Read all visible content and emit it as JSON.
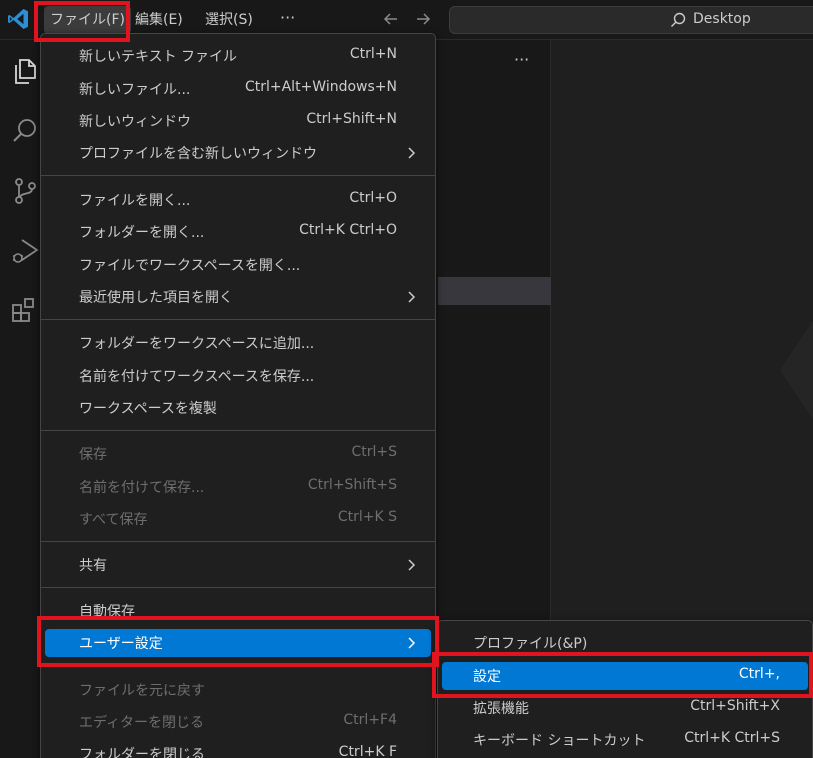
{
  "menubar": {
    "file": "ファイル(F)",
    "edit": "編集(E)",
    "selection": "選択(S)",
    "more": "···"
  },
  "search": {
    "text": "Desktop"
  },
  "sidebar": {
    "more": "···"
  },
  "file_menu": {
    "items": [
      {
        "label": "新しいテキスト ファイル",
        "shortcut": "Ctrl+N"
      },
      {
        "label": "新しいファイル...",
        "shortcut": "Ctrl+Alt+Windows+N"
      },
      {
        "label": "新しいウィンドウ",
        "shortcut": "Ctrl+Shift+N"
      },
      {
        "label": "プロファイルを含む新しいウィンドウ",
        "shortcut": ""
      },
      {
        "label": "ファイルを開く...",
        "shortcut": "Ctrl+O"
      },
      {
        "label": "フォルダーを開く...",
        "shortcut": "Ctrl+K Ctrl+O"
      },
      {
        "label": "ファイルでワークスペースを開く...",
        "shortcut": ""
      },
      {
        "label": "最近使用した項目を開く",
        "shortcut": ""
      },
      {
        "label": "フォルダーをワークスペースに追加...",
        "shortcut": ""
      },
      {
        "label": "名前を付けてワークスペースを保存...",
        "shortcut": ""
      },
      {
        "label": "ワークスペースを複製",
        "shortcut": ""
      },
      {
        "label": "保存",
        "shortcut": "Ctrl+S"
      },
      {
        "label": "名前を付けて保存...",
        "shortcut": "Ctrl+Shift+S"
      },
      {
        "label": "すべて保存",
        "shortcut": "Ctrl+K S"
      },
      {
        "label": "共有",
        "shortcut": ""
      },
      {
        "label": "自動保存",
        "shortcut": ""
      },
      {
        "label": "ユーザー設定",
        "shortcut": ""
      },
      {
        "label": "ファイルを元に戻す",
        "shortcut": ""
      },
      {
        "label": "エディターを閉じる",
        "shortcut": "Ctrl+F4"
      },
      {
        "label": "フォルダーを閉じる",
        "shortcut": "Ctrl+K F"
      }
    ]
  },
  "preferences_submenu": {
    "items": [
      {
        "label": "プロファイル(&P)",
        "shortcut": ""
      },
      {
        "label": "設定",
        "shortcut": "Ctrl+,"
      },
      {
        "label": "拡張機能",
        "shortcut": "Ctrl+Shift+X"
      },
      {
        "label": "キーボード ショートカット",
        "shortcut": "Ctrl+K Ctrl+S"
      }
    ]
  },
  "colors": {
    "accent": "#0078d4",
    "highlight_box": "#e0141e",
    "menu_bg": "#1f1f1f"
  }
}
